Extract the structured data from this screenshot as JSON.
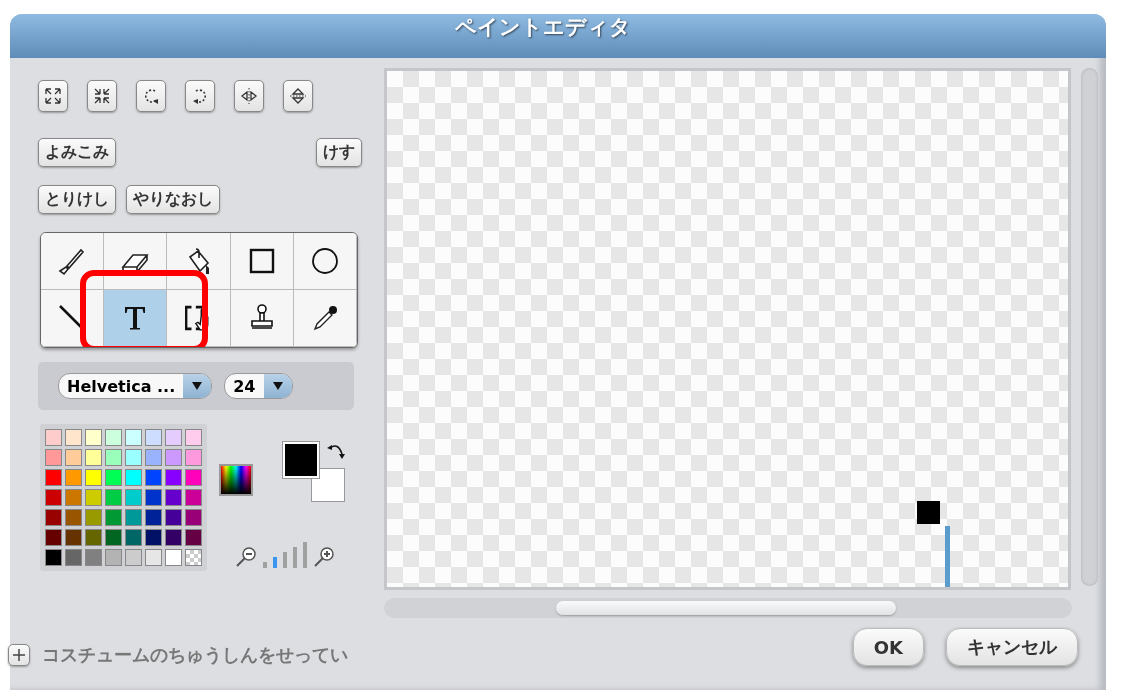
{
  "window": {
    "title": "ペイントエディタ"
  },
  "transform_buttons": [
    {
      "kind": "grow"
    },
    {
      "kind": "shrink"
    },
    {
      "kind": "rotate-left"
    },
    {
      "kind": "rotate-right"
    },
    {
      "kind": "flip-h"
    },
    {
      "kind": "flip-v"
    }
  ],
  "file_buttons": {
    "import": "よみこみ",
    "clear": "けす",
    "undo": "とりけし",
    "redo": "やりなおし"
  },
  "tools": [
    {
      "kind": "brush",
      "selected": false
    },
    {
      "kind": "eraser",
      "selected": false
    },
    {
      "kind": "fill",
      "selected": false
    },
    {
      "kind": "rectangle",
      "selected": false
    },
    {
      "kind": "ellipse",
      "selected": false
    },
    {
      "kind": "line",
      "selected": false
    },
    {
      "kind": "text",
      "selected": true
    },
    {
      "kind": "select",
      "selected": false
    },
    {
      "kind": "stamp",
      "selected": false
    },
    {
      "kind": "eyedropper",
      "selected": false
    }
  ],
  "highlight": {
    "kind": "text-tool"
  },
  "font": {
    "name": "Helvetica ...",
    "size": "24"
  },
  "palette": [
    [
      {
        "kind": "solid",
        "color": "#ffcccc"
      },
      {
        "kind": "solid",
        "color": "#ffe5cc"
      },
      {
        "kind": "solid",
        "color": "#ffffcc"
      },
      {
        "kind": "solid",
        "color": "#ccffdd"
      },
      {
        "kind": "solid",
        "color": "#ccffff"
      },
      {
        "kind": "solid",
        "color": "#ccddff"
      },
      {
        "kind": "solid",
        "color": "#e5ccff"
      },
      {
        "kind": "solid",
        "color": "#ffccee"
      }
    ],
    [
      {
        "kind": "solid",
        "color": "#ff9999"
      },
      {
        "kind": "solid",
        "color": "#ffcc99"
      },
      {
        "kind": "solid",
        "color": "#ffff99"
      },
      {
        "kind": "solid",
        "color": "#99ffbb"
      },
      {
        "kind": "solid",
        "color": "#99ffff"
      },
      {
        "kind": "solid",
        "color": "#99b3ff"
      },
      {
        "kind": "solid",
        "color": "#cc99ff"
      },
      {
        "kind": "solid",
        "color": "#ff99dd"
      }
    ],
    [
      {
        "kind": "solid",
        "color": "#ff0000"
      },
      {
        "kind": "solid",
        "color": "#ff9900"
      },
      {
        "kind": "solid",
        "color": "#ffff00"
      },
      {
        "kind": "solid",
        "color": "#00ff55"
      },
      {
        "kind": "solid",
        "color": "#00ffff"
      },
      {
        "kind": "solid",
        "color": "#0044ff"
      },
      {
        "kind": "solid",
        "color": "#8800ff"
      },
      {
        "kind": "solid",
        "color": "#ff00bb"
      }
    ],
    [
      {
        "kind": "solid",
        "color": "#cc0000"
      },
      {
        "kind": "solid",
        "color": "#cc7700"
      },
      {
        "kind": "solid",
        "color": "#cccc00"
      },
      {
        "kind": "solid",
        "color": "#00cc44"
      },
      {
        "kind": "solid",
        "color": "#00cccc"
      },
      {
        "kind": "solid",
        "color": "#0033cc"
      },
      {
        "kind": "solid",
        "color": "#6600cc"
      },
      {
        "kind": "solid",
        "color": "#cc0099"
      }
    ],
    [
      {
        "kind": "solid",
        "color": "#990000"
      },
      {
        "kind": "solid",
        "color": "#995500"
      },
      {
        "kind": "solid",
        "color": "#999900"
      },
      {
        "kind": "solid",
        "color": "#009933"
      },
      {
        "kind": "solid",
        "color": "#009999"
      },
      {
        "kind": "solid",
        "color": "#002299"
      },
      {
        "kind": "solid",
        "color": "#440099"
      },
      {
        "kind": "solid",
        "color": "#990077"
      }
    ],
    [
      {
        "kind": "solid",
        "color": "#660000"
      },
      {
        "kind": "solid",
        "color": "#663300"
      },
      {
        "kind": "solid",
        "color": "#666600"
      },
      {
        "kind": "solid",
        "color": "#006622"
      },
      {
        "kind": "solid",
        "color": "#006666"
      },
      {
        "kind": "solid",
        "color": "#001166"
      },
      {
        "kind": "solid",
        "color": "#330066"
      },
      {
        "kind": "solid",
        "color": "#660044"
      }
    ],
    [
      {
        "kind": "solid",
        "color": "#000000"
      },
      {
        "kind": "solid",
        "color": "#666666"
      },
      {
        "kind": "solid",
        "color": "#808080"
      },
      {
        "kind": "solid",
        "color": "#b3b3b3"
      },
      {
        "kind": "solid",
        "color": "#cccccc"
      },
      {
        "kind": "solid",
        "color": "#e6e6e6"
      },
      {
        "kind": "solid",
        "color": "#ffffff"
      },
      {
        "kind": "transparent"
      }
    ]
  ],
  "current_colors": [
    {
      "kind": "foreground",
      "color": "#000000"
    },
    {
      "kind": "background",
      "color": "#ffffff"
    }
  ],
  "zoom_steps": [
    {
      "selected": false
    },
    {
      "selected": true
    },
    {
      "selected": false
    },
    {
      "selected": false
    },
    {
      "selected": false
    }
  ],
  "costume_center": {
    "label": "コスチュームのちゅうしんをせってい"
  },
  "buttons": {
    "ok": "OK",
    "cancel": "キャンセル"
  }
}
